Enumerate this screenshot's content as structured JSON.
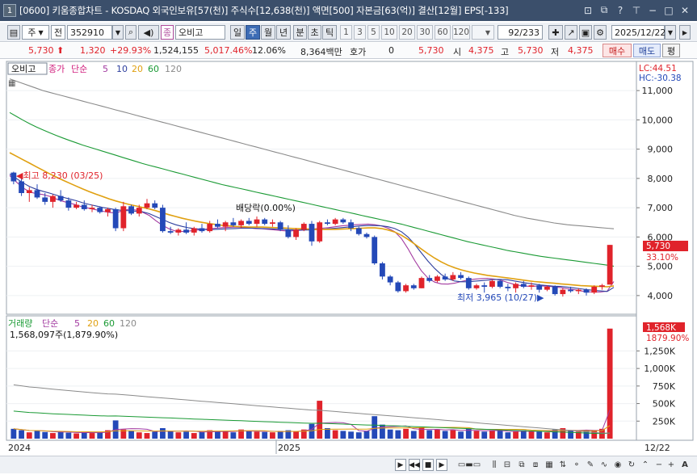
{
  "window": {
    "index": "1",
    "title": "[0600] 키움종합차트 - KOSDAQ 외국인보유[57(천)] 주식수[12,638(천)] 액면[500] 자본금[63(억)] 결산[12월] EPS[-133]"
  },
  "toolbar": {
    "market": "주",
    "market_type": "전",
    "code": "352910",
    "stock_icon": "종",
    "stock_name": "오비고",
    "periods": [
      "일",
      "주",
      "월",
      "년",
      "분",
      "초",
      "틱"
    ],
    "active_period": "주",
    "intervals": [
      "1",
      "3",
      "5",
      "10",
      "20",
      "30",
      "60",
      "120"
    ],
    "page_count": "92/233",
    "date": "2025/12/22"
  },
  "quote": {
    "price": "5,730",
    "change": "1,320",
    "change_pct": "+29.93%",
    "volume": "1,524,155",
    "volume_pct": "5,017.46%",
    "turnover": "12.06%",
    "amount": "8,364백만",
    "hoga_label": "호가",
    "hoga_value": "0",
    "hoga_price": "5,730",
    "open_label": "시",
    "open": "4,375",
    "high_label": "고",
    "high": "5,730",
    "low_label": "저",
    "low": "4,375",
    "buy_label": "매수",
    "sell_label": "매도",
    "flat_label": "평"
  },
  "price_panel": {
    "stock_tag": "오비고",
    "legend_close": "종가",
    "legend_ma": "단순",
    "ma_labels": [
      "5",
      "10",
      "20",
      "60",
      "120"
    ],
    "lc": "LC:44.51",
    "hc": "HC:-30.38",
    "max_label": "최고 8,230 (03/25)",
    "min_label": "최저 3,965 (10/27)",
    "dividend_label": "배당락(0.00%)",
    "last_price_tag": "5,730",
    "last_pct_tag": "33.10%"
  },
  "volume_panel": {
    "title": "거래량",
    "legend_ma": "단순",
    "ma_labels": [
      "5",
      "20",
      "60",
      "120"
    ],
    "current": "1,568,097주(1,879.90%)",
    "last_tag": "1,568K",
    "last_pct": "1879.90%"
  },
  "x_axis": {
    "labels": [
      "2024",
      "2025"
    ],
    "end_label": "12/22"
  },
  "colors": {
    "up": "#e0232b",
    "down": "#2449b8",
    "ma5": "#a23aa0",
    "ma10": "#2e3f9e",
    "ma20": "#e0a010",
    "ma60": "#1a9a34",
    "ma120": "#8a8a8a"
  },
  "chart_data": {
    "type": "candlestick",
    "interval": "weekly",
    "price_axis": {
      "min": 3500,
      "max": 11500,
      "ticks": [
        4000,
        5000,
        6000,
        7000,
        8000,
        9000,
        10000,
        11000
      ]
    },
    "volume_axis": {
      "min": 0,
      "max": 1600000,
      "ticks": [
        250000,
        500000,
        750000,
        1000000,
        1250000
      ]
    },
    "ma_series": [
      {
        "name": "5",
        "values": [
          8100,
          7880,
          7680,
          7540,
          7480,
          7450,
          7390,
          7300,
          7220,
          7160,
          7100,
          7020,
          6980,
          6930,
          6880,
          6840,
          6820,
          6900,
          6950,
          6920,
          6850,
          6740,
          6560,
          6400,
          6280,
          6200,
          6190,
          6200,
          6230,
          6250,
          6280,
          6300,
          6320,
          6330,
          6340,
          6330,
          6310,
          6290,
          6280,
          6260,
          6240,
          6220,
          6200,
          6220,
          6230,
          6250,
          6280,
          6300,
          6320,
          6350,
          6380,
          6400,
          6420,
          6430,
          6440,
          6420,
          6380,
          6300,
          6180,
          5950,
          5600,
          5200,
          4850,
          4600,
          4460,
          4400,
          4390,
          4420,
          4480,
          4530,
          4560,
          4580,
          4590,
          4560,
          4520,
          4450,
          4380,
          4340,
          4320,
          4320,
          4330,
          4320,
          4300,
          4270,
          4230,
          4200,
          4160,
          4130,
          4120,
          4120,
          4150,
          4480
        ]
      },
      {
        "name": "10",
        "values": [
          8150,
          8000,
          7850,
          7720,
          7630,
          7560,
          7500,
          7430,
          7360,
          7300,
          7240,
          7170,
          7110,
          7060,
          7010,
          6970,
          6930,
          6910,
          6900,
          6880,
          6860,
          6800,
          6700,
          6600,
          6500,
          6420,
          6360,
          6310,
          6280,
          6260,
          6250,
          6260,
          6270,
          6280,
          6290,
          6300,
          6300,
          6300,
          6290,
          6280,
          6270,
          6260,
          6250,
          6240,
          6240,
          6240,
          6250,
          6260,
          6280,
          6300,
          6320,
          6340,
          6360,
          6380,
          6390,
          6390,
          6380,
          6350,
          6290,
          6180,
          6000,
          5750,
          5460,
          5180,
          4930,
          4720,
          4580,
          4500,
          4470,
          4470,
          4490,
          4510,
          4530,
          4550,
          4550,
          4540,
          4500,
          4460,
          4420,
          4390,
          4360,
          4340,
          4320,
          4310,
          4290,
          4260,
          4230,
          4200,
          4180,
          4160,
          4140,
          4280
        ]
      },
      {
        "name": "20",
        "values": [
          8880,
          8760,
          8640,
          8520,
          8400,
          8280,
          8160,
          8050,
          7940,
          7840,
          7740,
          7640,
          7550,
          7460,
          7380,
          7300,
          7230,
          7170,
          7110,
          7060,
          7010,
          6960,
          6900,
          6830,
          6760,
          6700,
          6640,
          6590,
          6540,
          6500,
          6460,
          6430,
          6400,
          6380,
          6360,
          6350,
          6340,
          6340,
          6340,
          6330,
          6320,
          6310,
          6300,
          6290,
          6280,
          6270,
          6260,
          6260,
          6260,
          6260,
          6270,
          6280,
          6290,
          6300,
          6310,
          6310,
          6290,
          6240,
          6170,
          6060,
          5920,
          5760,
          5590,
          5430,
          5280,
          5150,
          5040,
          4950,
          4880,
          4820,
          4770,
          4730,
          4690,
          4660,
          4630,
          4600,
          4570,
          4540,
          4510,
          4480,
          4460,
          4440,
          4420,
          4400,
          4380,
          4360,
          4340,
          4330,
          4320,
          4310,
          4300,
          4330
        ]
      },
      {
        "name": "60",
        "values": [
          10250,
          10120,
          9990,
          9870,
          9760,
          9660,
          9560,
          9470,
          9380,
          9300,
          9220,
          9140,
          9070,
          9000,
          8930,
          8860,
          8790,
          8720,
          8650,
          8580,
          8510,
          8450,
          8390,
          8330,
          8270,
          8210,
          8150,
          8090,
          8030,
          7970,
          7910,
          7850,
          7790,
          7740,
          7690,
          7640,
          7590,
          7540,
          7490,
          7440,
          7390,
          7340,
          7290,
          7240,
          7190,
          7140,
          7090,
          7040,
          6990,
          6940,
          6890,
          6840,
          6790,
          6740,
          6690,
          6640,
          6590,
          6540,
          6490,
          6440,
          6380,
          6320,
          6260,
          6200,
          6140,
          6080,
          6020,
          5960,
          5900,
          5840,
          5790,
          5740,
          5690,
          5640,
          5590,
          5540,
          5500,
          5460,
          5420,
          5380,
          5340,
          5310,
          5280,
          5250,
          5220,
          5190,
          5160,
          5130,
          5100,
          5070,
          5040,
          5000
        ]
      },
      {
        "name": "120",
        "values": [
          11400,
          11320,
          11240,
          11160,
          11080,
          11000,
          10940,
          10880,
          10820,
          10760,
          10700,
          10640,
          10580,
          10520,
          10460,
          10400,
          10340,
          10280,
          10220,
          10160,
          10100,
          10040,
          9980,
          9920,
          9860,
          9800,
          9740,
          9680,
          9620,
          9560,
          9500,
          9440,
          9380,
          9320,
          9260,
          9200,
          9140,
          9080,
          9020,
          8960,
          8900,
          8840,
          8780,
          8720,
          8660,
          8600,
          8540,
          8480,
          8420,
          8360,
          8300,
          8240,
          8180,
          8120,
          8060,
          8000,
          7940,
          7880,
          7820,
          7760,
          7700,
          7640,
          7580,
          7520,
          7460,
          7400,
          7340,
          7280,
          7220,
          7160,
          7100,
          7040,
          6980,
          6920,
          6860,
          6800,
          6740,
          6690,
          6640,
          6600,
          6560,
          6520,
          6480,
          6450,
          6420,
          6400,
          6380,
          6360,
          6340,
          6320,
          6300,
          6280
        ]
      }
    ],
    "candles": [
      [
        8200,
        8230,
        7800,
        7900
      ],
      [
        7900,
        8050,
        7400,
        7500
      ],
      [
        7500,
        7700,
        7200,
        7600
      ],
      [
        7600,
        7800,
        7300,
        7350
      ],
      [
        7350,
        7500,
        7100,
        7200
      ],
      [
        7200,
        7450,
        7000,
        7400
      ],
      [
        7400,
        7600,
        7200,
        7250
      ],
      [
        7250,
        7350,
        6900,
        7000
      ],
      [
        7000,
        7200,
        6950,
        7100
      ],
      [
        7100,
        7250,
        6900,
        6950
      ],
      [
        6950,
        7100,
        6850,
        7000
      ],
      [
        7000,
        7050,
        6800,
        6850
      ],
      [
        6850,
        7000,
        6700,
        6950
      ],
      [
        6950,
        7000,
        6200,
        6300
      ],
      [
        6300,
        7200,
        6200,
        7050
      ],
      [
        7050,
        7100,
        6750,
        6800
      ],
      [
        6800,
        7100,
        6700,
        7000
      ],
      [
        7000,
        7300,
        6950,
        7150
      ],
      [
        7150,
        7250,
        6950,
        7000
      ],
      [
        7000,
        7100,
        6150,
        6200
      ],
      [
        6200,
        6350,
        6100,
        6150
      ],
      [
        6150,
        6300,
        6050,
        6250
      ],
      [
        6250,
        6500,
        6100,
        6150
      ],
      [
        6150,
        6350,
        6050,
        6300
      ],
      [
        6300,
        6450,
        6150,
        6200
      ],
      [
        6200,
        6550,
        6150,
        6450
      ],
      [
        6450,
        6600,
        6300,
        6350
      ],
      [
        6350,
        6550,
        6200,
        6500
      ],
      [
        6500,
        6650,
        6350,
        6400
      ],
      [
        6400,
        6600,
        6300,
        6550
      ],
      [
        6550,
        6650,
        6400,
        6450
      ],
      [
        6450,
        6700,
        6350,
        6600
      ],
      [
        6600,
        6650,
        6400,
        6450
      ],
      [
        6450,
        6600,
        6350,
        6500
      ],
      [
        6500,
        6550,
        6200,
        6250
      ],
      [
        6250,
        6400,
        5950,
        6000
      ],
      [
        6000,
        6300,
        5900,
        6250
      ],
      [
        6250,
        6500,
        6200,
        6450
      ],
      [
        6450,
        6550,
        5700,
        5850
      ],
      [
        5850,
        6550,
        5800,
        6500
      ],
      [
        6500,
        6600,
        6400,
        6450
      ],
      [
        6450,
        6650,
        6400,
        6600
      ],
      [
        6600,
        6650,
        6450,
        6500
      ],
      [
        6500,
        6600,
        6200,
        6300
      ],
      [
        6300,
        6350,
        6050,
        6100
      ],
      [
        6100,
        6150,
        5950,
        6000
      ],
      [
        6000,
        6050,
        5050,
        5100
      ],
      [
        5100,
        5150,
        4550,
        4650
      ],
      [
        4650,
        4700,
        4350,
        4450
      ],
      [
        4450,
        4500,
        4100,
        4150
      ],
      [
        4150,
        4400,
        4100,
        4350
      ],
      [
        4350,
        4400,
        4200,
        4250
      ],
      [
        4250,
        4650,
        4250,
        4600
      ],
      [
        4600,
        4700,
        4450,
        4500
      ],
      [
        4500,
        4700,
        4450,
        4650
      ],
      [
        4650,
        4750,
        4500,
        4550
      ],
      [
        4550,
        4800,
        4500,
        4700
      ],
      [
        4700,
        4800,
        4550,
        4600
      ],
      [
        4600,
        4650,
        4200,
        4250
      ],
      [
        4250,
        4400,
        4200,
        4350
      ],
      [
        4350,
        4450,
        4100,
        4300
      ],
      [
        4300,
        4550,
        4250,
        4500
      ],
      [
        4500,
        4550,
        4250,
        4300
      ],
      [
        4300,
        4400,
        4150,
        4250
      ],
      [
        4250,
        4450,
        4100,
        4400
      ],
      [
        4400,
        4500,
        4250,
        4300
      ],
      [
        4300,
        4450,
        4200,
        4350
      ],
      [
        4350,
        4400,
        4100,
        4200
      ],
      [
        4200,
        4350,
        4150,
        4300
      ],
      [
        4300,
        4350,
        4000,
        4050
      ],
      [
        4050,
        4250,
        3965,
        4200
      ],
      [
        4200,
        4300,
        4100,
        4150
      ],
      [
        4150,
        4250,
        4050,
        4200
      ],
      [
        4200,
        4250,
        4000,
        4100
      ],
      [
        4100,
        4350,
        4050,
        4300
      ],
      [
        4300,
        4400,
        4200,
        4350
      ],
      [
        4375,
        5730,
        4375,
        5730
      ]
    ],
    "volumes": [
      140000,
      120000,
      90000,
      110000,
      95000,
      80000,
      100000,
      85000,
      75000,
      90000,
      80000,
      95000,
      120000,
      260000,
      130000,
      110000,
      90000,
      80000,
      100000,
      150000,
      110000,
      90000,
      100000,
      80000,
      95000,
      120000,
      110000,
      100000,
      90000,
      130000,
      110000,
      100000,
      95000,
      90000,
      110000,
      120000,
      100000,
      130000,
      210000,
      540000,
      150000,
      120000,
      110000,
      100000,
      90000,
      110000,
      320000,
      200000,
      130000,
      120000,
      140000,
      110000,
      160000,
      120000,
      130000,
      110000,
      120000,
      100000,
      140000,
      110000,
      100000,
      120000,
      110000,
      90000,
      100000,
      120000,
      100000,
      110000,
      90000,
      130000,
      150000,
      110000,
      100000,
      120000,
      110000,
      140000,
      1568097
    ]
  }
}
